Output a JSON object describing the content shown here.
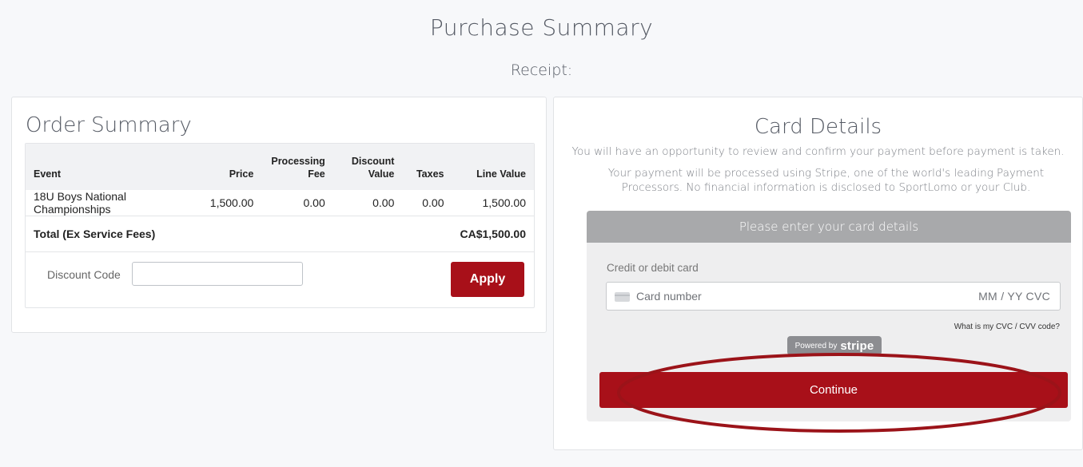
{
  "page": {
    "title": "Purchase Summary",
    "receipt_label": "Receipt:"
  },
  "order": {
    "title": "Order Summary",
    "columns": {
      "event": "Event",
      "price": "Price",
      "processing_fee_1": "Processing",
      "processing_fee_2": "Fee",
      "discount_value_1": "Discount",
      "discount_value_2": "Value",
      "taxes": "Taxes",
      "line_value": "Line Value"
    },
    "rows": [
      {
        "event": "18U Boys National Championships",
        "price": "1,500.00",
        "processing_fee": "0.00",
        "discount_value": "0.00",
        "taxes": "0.00",
        "line_value": "1,500.00"
      }
    ],
    "total_label": "Total (Ex Service Fees)",
    "total_value": "CA$1,500.00",
    "discount_code_label": "Discount Code",
    "discount_code_value": "",
    "apply_label": "Apply"
  },
  "card": {
    "title": "Card Details",
    "note1": "You will have an opportunity to review and confirm your payment before payment is taken.",
    "note2": "Your payment will be processed using Stripe, one of the world's leading Payment Processors. No financial information is disclosed to SportLomo or your Club.",
    "box_header": "Please enter your card details",
    "credit_label": "Credit or debit card",
    "card_number_placeholder": "Card number",
    "expiry_cvc_placeholder": "MM / YY  CVC",
    "cvc_help": "What is my CVC / CVV code?",
    "powered_by": "Powered by",
    "stripe": "stripe",
    "continue_label": "Continue"
  },
  "colors": {
    "accent": "#a81019",
    "card_header": "#a8a9ab",
    "annotation": "#9b1319"
  },
  "icons": {
    "card_brand": "credit-card-icon"
  }
}
